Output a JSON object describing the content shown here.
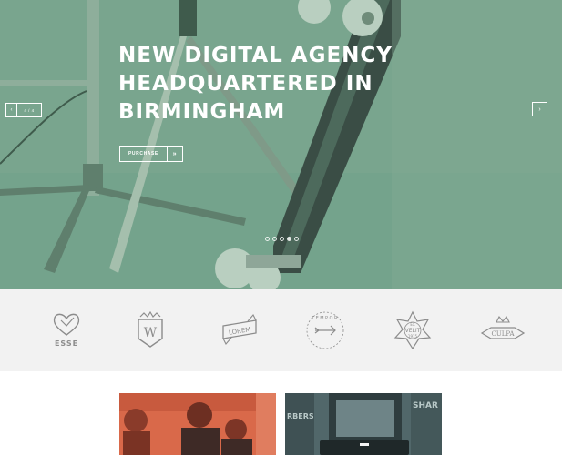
{
  "hero": {
    "title_lines": [
      "NEW DIGITAL AGENCY",
      "HEADQUARTERED IN",
      "BIRMINGHAM"
    ],
    "purchase_label": "PURCHASE",
    "purchase_arrow": "»",
    "slide_counter": "4 / 4",
    "prev_icon": "‹",
    "next_icon": "›",
    "accent_color": "#6f9f87"
  },
  "logos": [
    {
      "name": "heart",
      "text": "ESSE"
    },
    {
      "name": "crest",
      "text": "W"
    },
    {
      "name": "ribbon",
      "text": "LOREM"
    },
    {
      "name": "circle",
      "text": "TEMPOR"
    },
    {
      "name": "star",
      "text_top": "EX",
      "text": "VELIT",
      "text_bottom": "1915"
    },
    {
      "name": "crown",
      "text": "CULPA"
    }
  ],
  "cards": [
    {
      "name": "team-photo",
      "color": "#d9694a"
    },
    {
      "name": "barbers-photo",
      "color": "#51676a",
      "sign_text": "SHAR",
      "shop_text": "RBERS"
    }
  ]
}
